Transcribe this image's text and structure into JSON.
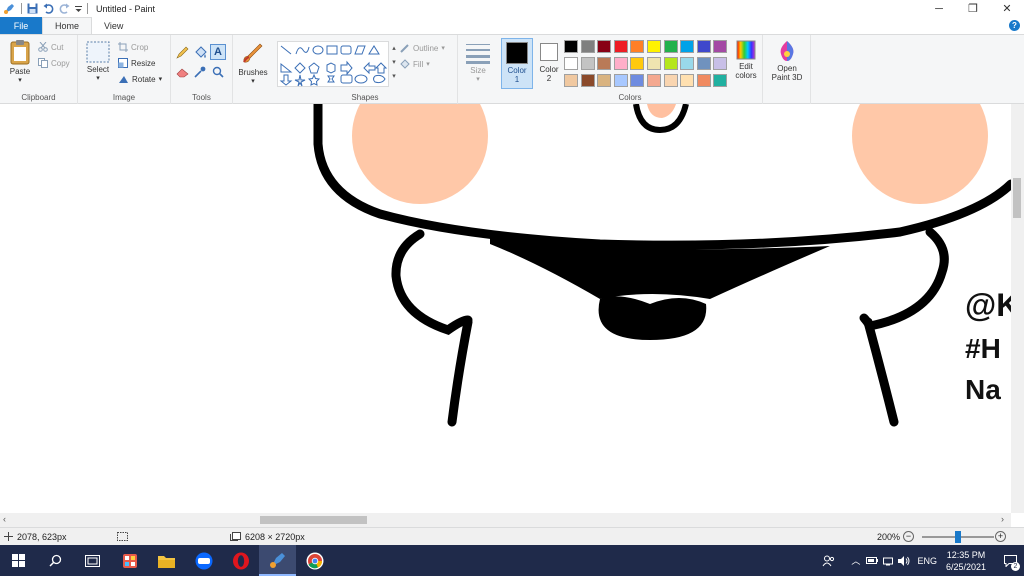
{
  "window": {
    "title": "Untitled - Paint",
    "minimize": "─",
    "maximize": "❐",
    "close": "✕"
  },
  "tabs": {
    "file": "File",
    "home": "Home",
    "view": "View"
  },
  "clipboard": {
    "group": "Clipboard",
    "paste": "Paste",
    "cut": "Cut",
    "copy": "Copy"
  },
  "image": {
    "group": "Image",
    "select": "Select",
    "crop": "Crop",
    "resize": "Resize",
    "rotate": "Rotate"
  },
  "tools": {
    "group": "Tools"
  },
  "brushes": {
    "label": "Brushes"
  },
  "shapes": {
    "group": "Shapes",
    "outline": "Outline",
    "fill": "Fill"
  },
  "size": {
    "label": "Size"
  },
  "colors": {
    "group": "Colors",
    "color1_label": "Color",
    "color1_num": "1",
    "color2_label": "Color",
    "color2_num": "2",
    "edit_label": "Edit",
    "edit_label2": "colors",
    "color1_value": "#000000",
    "color2_value": "#ffffff",
    "palette_row1": [
      "#000000",
      "#7f7f7f",
      "#880015",
      "#ed1c24",
      "#ff7f27",
      "#fff200",
      "#22b14c",
      "#00a2e8",
      "#3f48cc",
      "#a349a4"
    ],
    "palette_row2": [
      "#ffffff",
      "#c3c3c3",
      "#b97a57",
      "#ffaec9",
      "#ffc90e",
      "#efe4b0",
      "#b5e61d",
      "#99d9ea",
      "#7092be",
      "#c8bfe7"
    ],
    "palette_row3": [
      "#f0c8a0",
      "#8b4a2b",
      "#d9b380",
      "#a8c8ff",
      "#6f8ce0",
      "#f4a890",
      "#f9d5b0",
      "#ffe0b0",
      "#f08a60",
      "#20b0a0"
    ]
  },
  "paint3d": {
    "label": "Open",
    "label2": "Paint 3D"
  },
  "canvas": {
    "text_line1": "@K",
    "text_line2": "#H",
    "text_line3": "Na",
    "blush_color": "#ffc8a8"
  },
  "status": {
    "cursor": "2078, 623px",
    "size": "6208 × 2720px",
    "zoom": "200%"
  },
  "tray": {
    "lang": "ENG",
    "time": "12:35 PM",
    "date": "6/25/2021",
    "notif": "2"
  }
}
